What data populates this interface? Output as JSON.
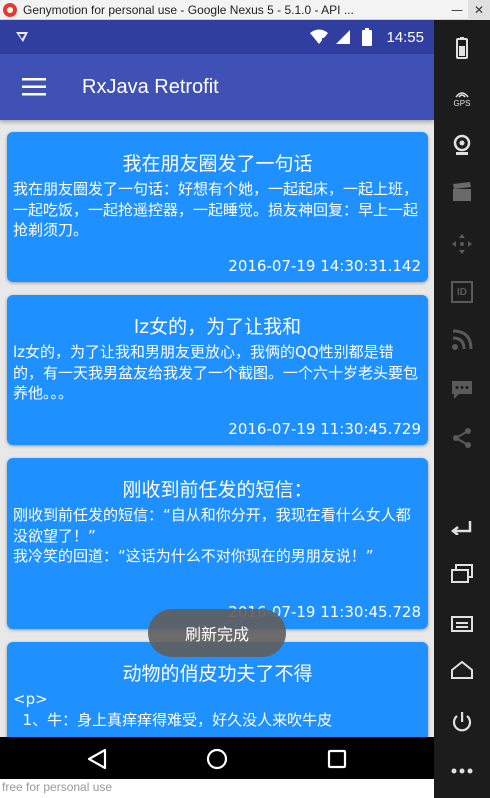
{
  "window": {
    "title": "Genymotion for personal use - Google Nexus 5 - 5.1.0 - API ...",
    "min_glyph": "—",
    "close_glyph": "✕"
  },
  "statusbar": {
    "clock": "14:55"
  },
  "appbar": {
    "title": "RxJava Retrofit"
  },
  "cards": [
    {
      "title": "我在朋友圈发了一句话",
      "body": "我在朋友圈发了一句话：好想有个她，一起起床，一起上班，一起吃饭，一起抢遥控器，一起睡觉。损友神回复：早上一起抢剃须刀。",
      "time": "2016-07-19 14:30:31.142"
    },
    {
      "title": "lz女的，为了让我和",
      "body": "lz女的，为了让我和男朋友更放心，我俩的QQ性别都是错的，有一天我男盆友给我发了一个截图。一个六十岁老头要包养他。。。",
      "time": "2016-07-19 11:30:45.729"
    },
    {
      "title": "刚收到前任发的短信：",
      "body": "刚收到前任发的短信：“自从和你分开，我现在看什么女人都没欲望了！”\n我冷笑的回道：“这话为什么不对你现在的男朋友说！”",
      "time": "2016-07-19 11:30:45.728"
    },
    {
      "title": "动物的俏皮功夫了不得",
      "body": "<p>\n  1、牛：身上真痒痒得难受，好久没人来吹牛皮",
      "time": ""
    }
  ],
  "toast": {
    "text": "刷新完成"
  },
  "sidebar": {
    "gps_label": "GPS",
    "id_label": "ID"
  },
  "footer": {
    "watermark": "free for personal use"
  },
  "colors": {
    "statusbar": "#303f9f",
    "appbar": "#3f51b5",
    "card": "#1e90ff",
    "background": "#e8e8e8"
  }
}
